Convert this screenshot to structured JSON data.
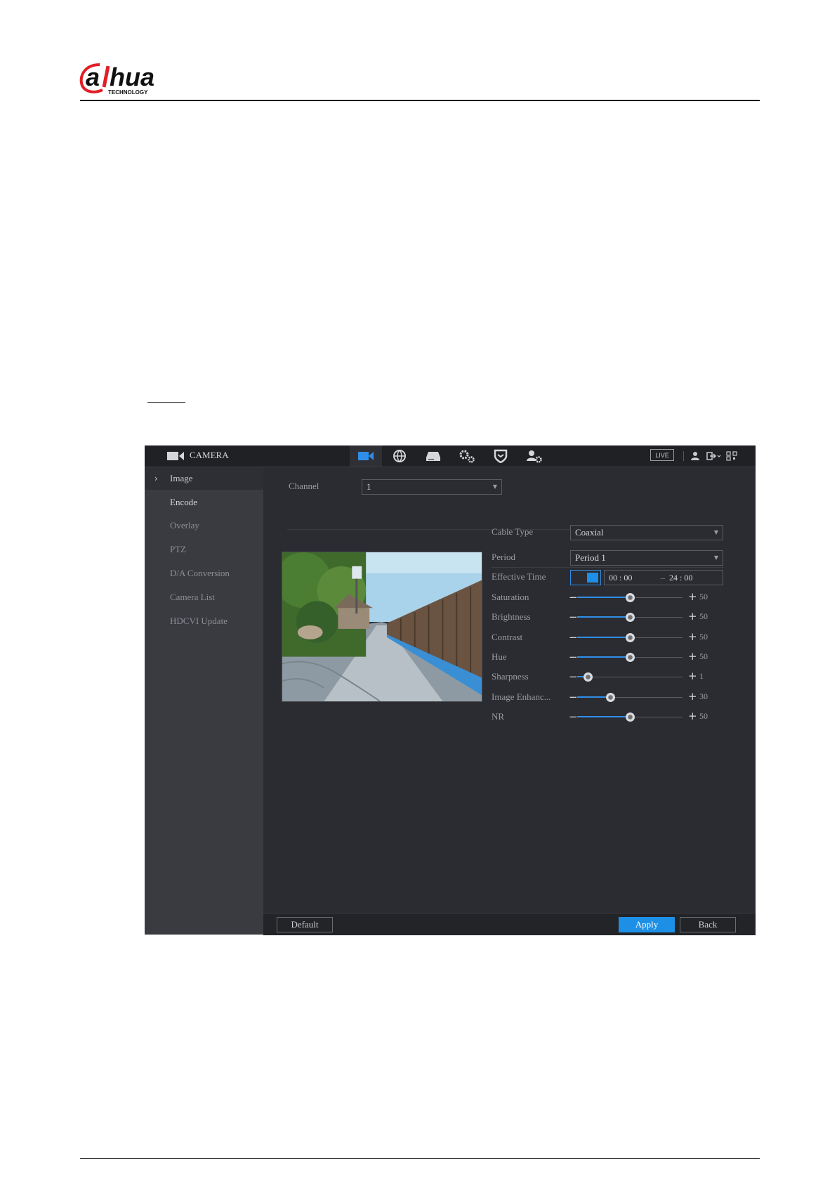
{
  "document": {
    "logo_text": "alhua",
    "logo_subtext": "TECHNOLOGY",
    "brand_color": "#e01f26"
  },
  "app": {
    "title": "CAMERA",
    "top_nav": [
      {
        "icon": "camera-icon",
        "active": true
      },
      {
        "icon": "network-icon",
        "active": false
      },
      {
        "icon": "storage-icon",
        "active": false
      },
      {
        "icon": "system-settings-icon",
        "active": false
      },
      {
        "icon": "security-shield-icon",
        "active": false
      },
      {
        "icon": "account-settings-icon",
        "active": false
      }
    ],
    "live_label": "LIVE",
    "accent_color": "#1e8fe6",
    "sidebar": {
      "items": [
        {
          "label": "Image",
          "active": true
        },
        {
          "label": "Encode"
        },
        {
          "label": "Overlay"
        },
        {
          "label": "PTZ"
        },
        {
          "label": "D/A Conversion"
        },
        {
          "label": "Camera List"
        },
        {
          "label": "HDCVI Update"
        }
      ]
    },
    "main": {
      "channel_label": "Channel",
      "channel_value": "1",
      "cable_type_label": "Cable Type",
      "cable_type_value": "Coaxial",
      "period_label": "Period",
      "period_value": "Period 1",
      "effective_time_label": "Effective Time",
      "effective_time_start": "00 : 00",
      "effective_time_sep": "–",
      "effective_time_end": "24 : 00",
      "sliders": [
        {
          "label": "Saturation",
          "value": "50",
          "fraction": 0.5
        },
        {
          "label": "Brightness",
          "value": "50",
          "fraction": 0.5
        },
        {
          "label": "Contrast",
          "value": "50",
          "fraction": 0.5
        },
        {
          "label": "Hue",
          "value": "50",
          "fraction": 0.5
        },
        {
          "label": "Sharpness",
          "value": "1",
          "fraction": 0.1
        },
        {
          "label": "Image Enhanc...",
          "value": "30",
          "fraction": 0.31
        },
        {
          "label": "NR",
          "value": "50",
          "fraction": 0.5
        }
      ]
    },
    "buttons": {
      "default": "Default",
      "apply": "Apply",
      "back": "Back"
    }
  }
}
